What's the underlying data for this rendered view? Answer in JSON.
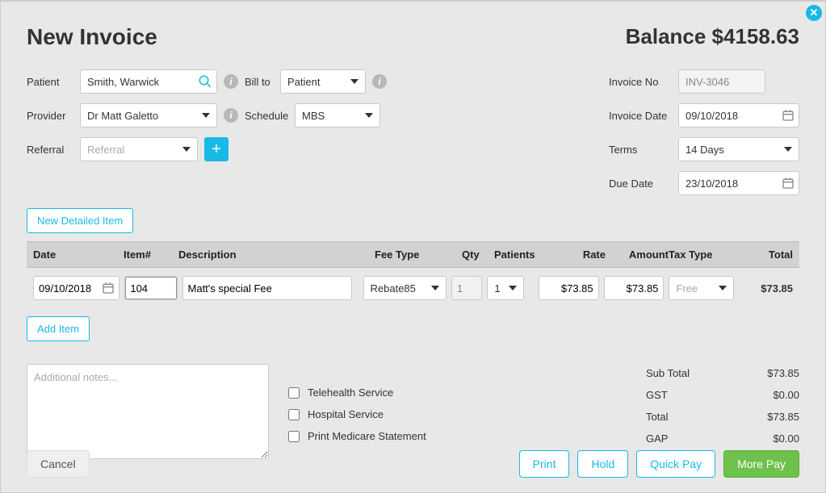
{
  "header": {
    "title": "New Invoice",
    "balance": "Balance $4158.63"
  },
  "left_form": {
    "patient_label": "Patient",
    "patient_value": "Smith, Warwick",
    "billto_label": "Bill to",
    "billto_value": "Patient",
    "provider_label": "Provider",
    "provider_value": "Dr Matt Galetto",
    "schedule_label": "Schedule",
    "schedule_value": "MBS",
    "referral_label": "Referral",
    "referral_placeholder": "Referral"
  },
  "right_form": {
    "invoice_no_label": "Invoice No",
    "invoice_no_value": "INV-3046",
    "invoice_date_label": "Invoice Date",
    "invoice_date_value": "09/10/2018",
    "terms_label": "Terms",
    "terms_value": "14 Days",
    "due_date_label": "Due Date",
    "due_date_value": "23/10/2018"
  },
  "buttons": {
    "new_detailed": "New Detailed Item",
    "add_item": "Add Item",
    "cancel": "Cancel",
    "print": "Print",
    "hold": "Hold",
    "quick_pay": "Quick Pay",
    "more_pay": "More Pay"
  },
  "table": {
    "head": {
      "date": "Date",
      "item": "Item#",
      "desc": "Description",
      "fee": "Fee Type",
      "qty": "Qty",
      "patients": "Patients",
      "rate": "Rate",
      "amount": "Amount",
      "tax": "Tax Type",
      "total": "Total"
    },
    "row": {
      "date": "09/10/2018",
      "item": "104",
      "desc": "Matt's special Fee",
      "fee": "Rebate85",
      "qty": "1",
      "patients": "1",
      "rate": "$73.85",
      "amount": "$73.85",
      "tax": "Free",
      "total": "$73.85"
    }
  },
  "notes_placeholder": "Additional notes...",
  "checks": {
    "telehealth": "Telehealth Service",
    "hospital": "Hospital Service",
    "medicare": "Print Medicare Statement"
  },
  "totals": {
    "sub_label": "Sub Total",
    "sub_value": "$73.85",
    "gst_label": "GST",
    "gst_value": "$0.00",
    "total_label": "Total",
    "total_value": "$73.85",
    "gap_label": "GAP",
    "gap_value": "$0.00"
  }
}
